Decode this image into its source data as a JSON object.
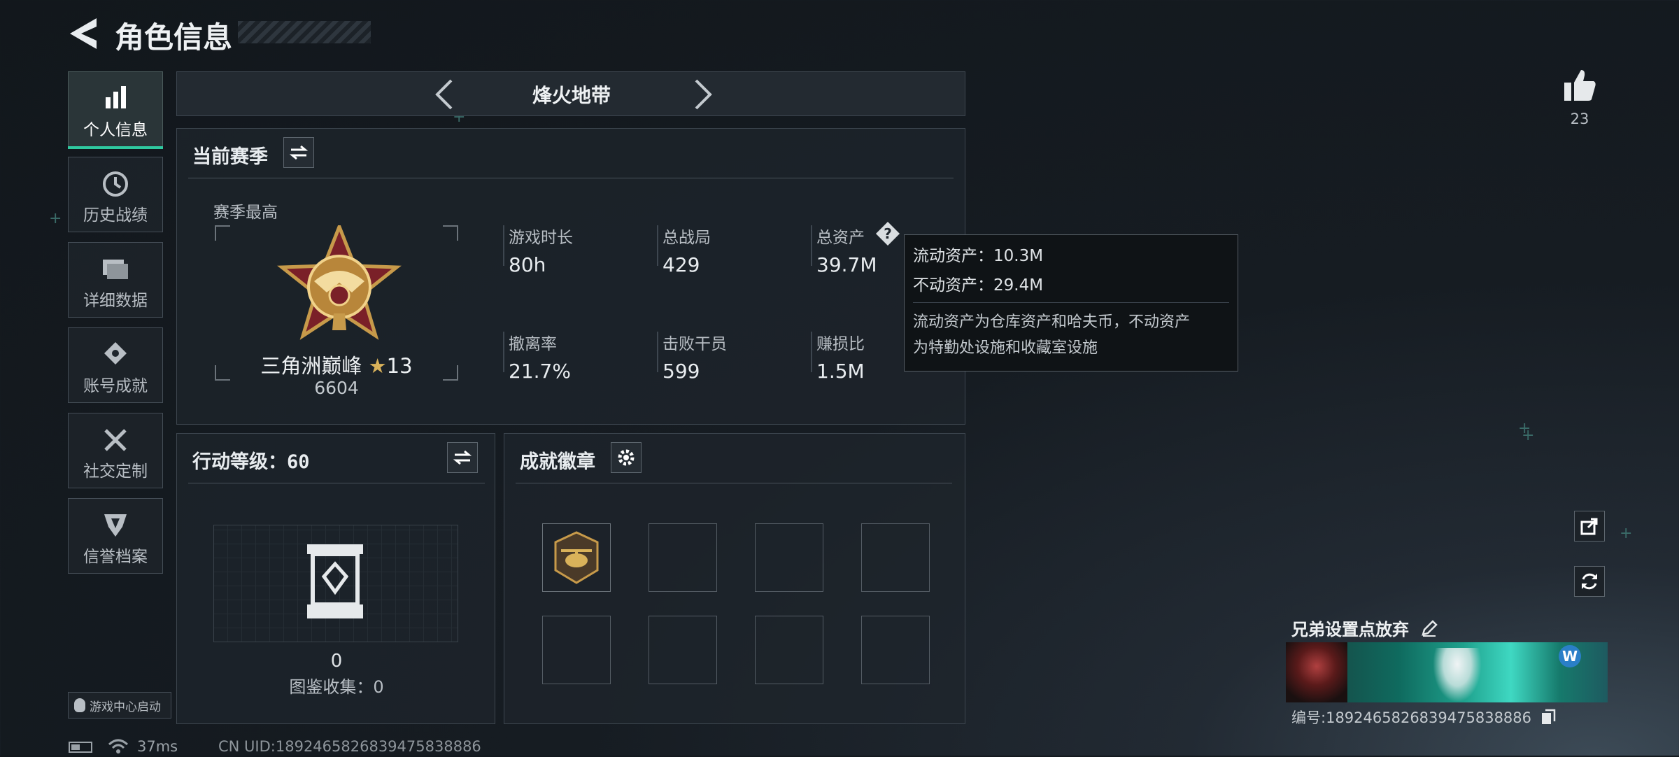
{
  "header": {
    "title": "角色信息"
  },
  "nav": [
    {
      "label": "个人信息",
      "icon": "bar-chart-icon",
      "active": true
    },
    {
      "label": "历史战绩",
      "icon": "history-clock-icon"
    },
    {
      "label": "详细数据",
      "icon": "folder-icon"
    },
    {
      "label": "账号成就",
      "icon": "achievement-icon"
    },
    {
      "label": "社交定制",
      "icon": "tools-icon"
    },
    {
      "label": "信誉档案",
      "icon": "reputation-icon"
    }
  ],
  "mode": {
    "label": "烽火地带"
  },
  "season": {
    "title": "当前赛季",
    "best_label": "赛季最高",
    "rank_name": "三角洲巅峰",
    "rank_stars": "13",
    "rank_points": "6604",
    "stats": [
      {
        "label": "游戏时长",
        "value": "80h"
      },
      {
        "label": "总战局",
        "value": "429"
      },
      {
        "label": "总资产",
        "value": "39.7M"
      },
      {
        "label": "撤离率",
        "value": "21.7%"
      },
      {
        "label": "击败干员",
        "value": "599"
      },
      {
        "label": "赚损比",
        "value": "1.5M"
      }
    ]
  },
  "tooltip": {
    "liquid_label": "流动资产：",
    "liquid_value": "10.3M",
    "fixed_label": "不动资产：",
    "fixed_value": "29.4M",
    "desc_line1": "流动资产为仓库资产和哈夫币，不动资产",
    "desc_line2": "为特勤处设施和收藏室设施"
  },
  "action_level": {
    "title": "行动等级：",
    "level": "60",
    "count": "0",
    "collect_label": "图鉴收集：",
    "collect_value": "0"
  },
  "badges": {
    "title": "成就徽章"
  },
  "likes": {
    "count": "23"
  },
  "profile": {
    "name": "兄弟设置点放弃",
    "id_label": "编号:",
    "id_value": "1892465826839475838886"
  },
  "footer": {
    "launch_label": "游戏中心启动",
    "ping": "37ms",
    "uid": "CN UID:1892465826839475838886"
  },
  "colors": {
    "accent": "#2fc9a0",
    "bg": "#161c22",
    "panel": "#1f262d"
  }
}
